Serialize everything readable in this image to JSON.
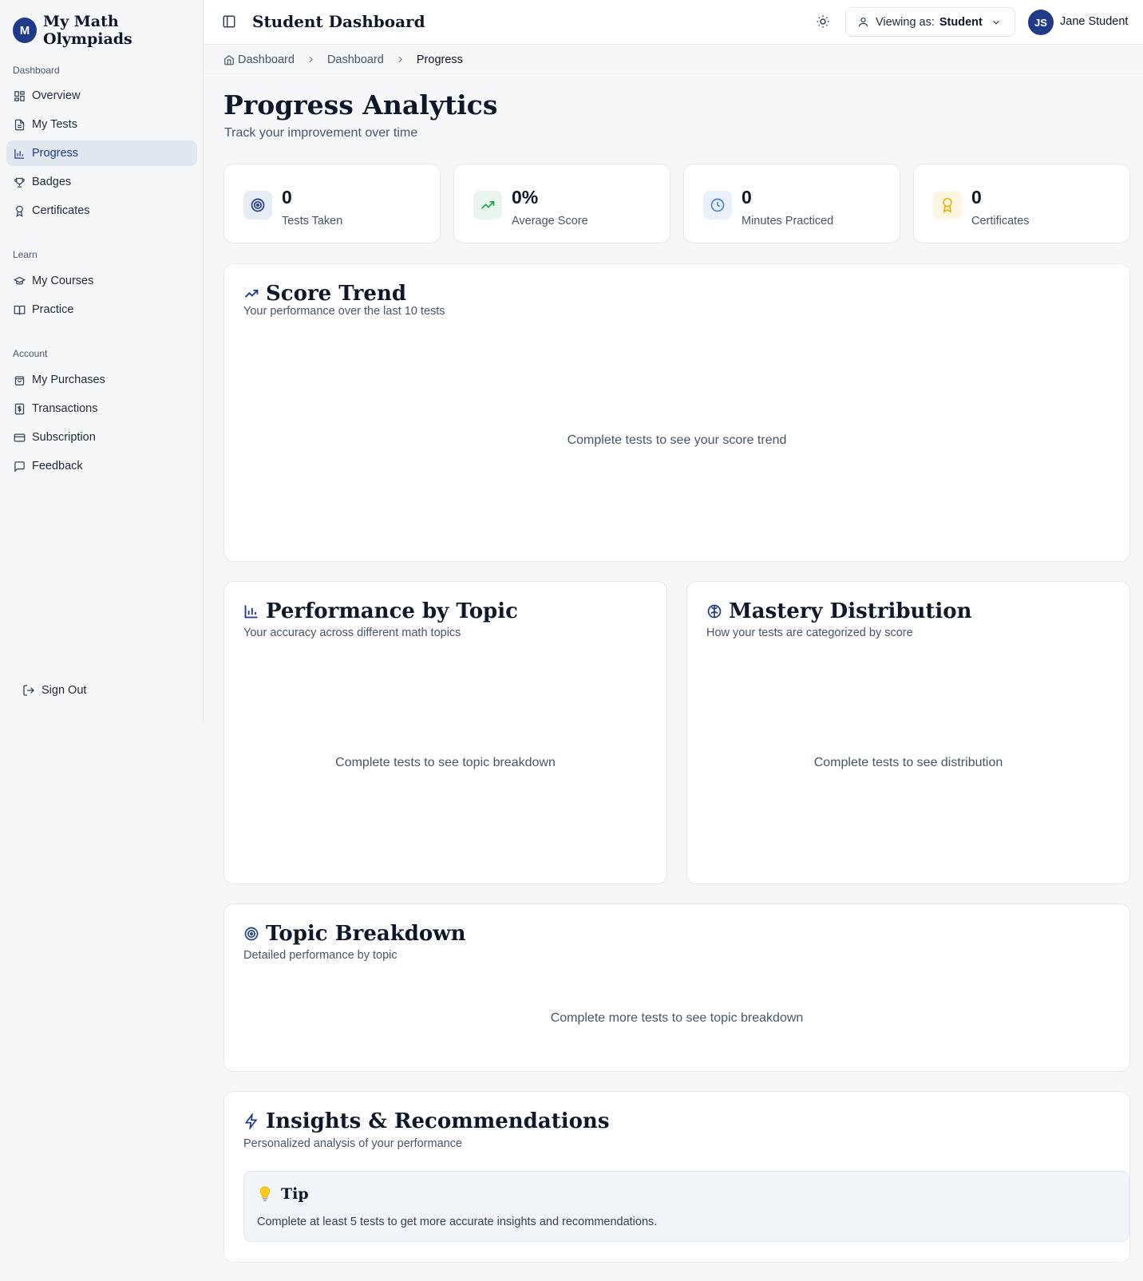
{
  "brand": {
    "initial": "M",
    "name": "My Math Olympiads"
  },
  "sidebar": {
    "sections": [
      {
        "title": "Dashboard",
        "items": [
          {
            "label": "Overview",
            "icon": "grid-icon"
          },
          {
            "label": "My Tests",
            "icon": "file-icon"
          },
          {
            "label": "Progress",
            "icon": "bar-chart-icon",
            "active": true
          },
          {
            "label": "Badges",
            "icon": "trophy-icon"
          },
          {
            "label": "Certificates",
            "icon": "award-icon"
          }
        ]
      },
      {
        "title": "Learn",
        "items": [
          {
            "label": "My Courses",
            "icon": "graduation-cap-icon"
          },
          {
            "label": "Practice",
            "icon": "book-open-icon"
          }
        ]
      },
      {
        "title": "Account",
        "items": [
          {
            "label": "My Purchases",
            "icon": "shopping-bag-icon"
          },
          {
            "label": "Transactions",
            "icon": "receipt-icon"
          },
          {
            "label": "Subscription",
            "icon": "credit-card-icon"
          },
          {
            "label": "Feedback",
            "icon": "message-square-icon"
          }
        ]
      }
    ],
    "sign_out": "Sign Out"
  },
  "topbar": {
    "title": "Student Dashboard",
    "viewing_label": "Viewing as:",
    "viewing_value": "Student",
    "user_initials": "JS",
    "user_name": "Jane Student"
  },
  "breadcrumb": [
    "Dashboard",
    "Dashboard",
    "Progress"
  ],
  "page": {
    "title": "Progress Analytics",
    "subtitle": "Track your improvement over time"
  },
  "stats": [
    {
      "value": "0",
      "label": "Tests Taken",
      "icon": "target-icon",
      "color": "#1e3a8a",
      "bg": "#e6ebf5"
    },
    {
      "value": "0%",
      "label": "Average Score",
      "icon": "trending-up-icon",
      "color": "#16a34a",
      "bg": "#e8f6ee"
    },
    {
      "value": "0",
      "label": "Minutes Practiced",
      "icon": "clock-icon",
      "color": "#3b82f6",
      "bg": "#eaf1fd"
    },
    {
      "value": "0",
      "label": "Certificates",
      "icon": "award-icon",
      "color": "#eab308",
      "bg": "#fdf6e3"
    }
  ],
  "score_trend": {
    "title": "Score Trend",
    "subtitle": "Your performance over the last 10 tests",
    "empty": "Complete tests to see your score trend"
  },
  "performance_by_topic": {
    "title": "Performance by Topic",
    "subtitle": "Your accuracy across different math topics",
    "empty": "Complete tests to see topic breakdown"
  },
  "mastery_distribution": {
    "title": "Mastery Distribution",
    "subtitle": "How your tests are categorized by score",
    "empty": "Complete tests to see distribution"
  },
  "topic_breakdown": {
    "title": "Topic Breakdown",
    "subtitle": "Detailed performance by topic",
    "empty": "Complete more tests to see topic breakdown"
  },
  "insights": {
    "title": "Insights & Recommendations",
    "subtitle": "Personalized analysis of your performance",
    "tip_title": "Tip",
    "tip_text": "Complete at least 5 tests to get more accurate insights and recommendations."
  }
}
